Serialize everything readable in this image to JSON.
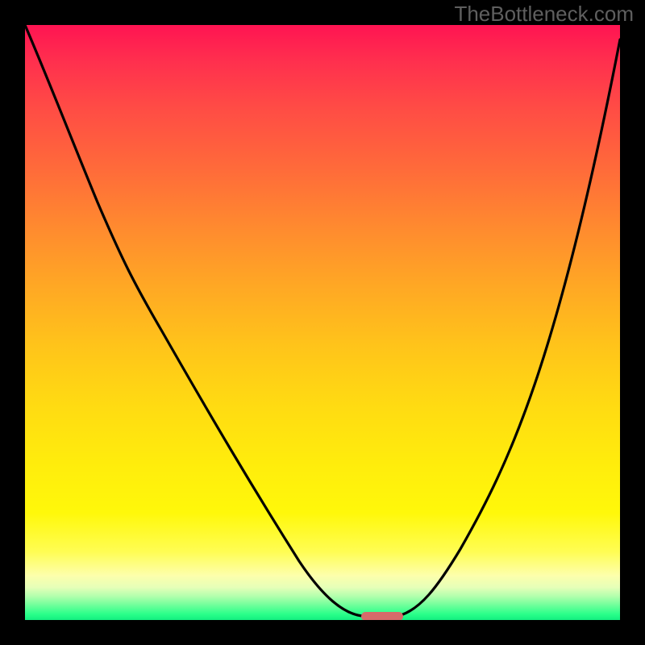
{
  "watermark": "TheBottleneck.com",
  "chart_data": {
    "type": "line",
    "title": "",
    "xlabel": "",
    "ylabel": "",
    "xlim": [
      0,
      100
    ],
    "ylim": [
      0,
      100
    ],
    "series": [
      {
        "name": "bottleneck-curve",
        "x": [
          0,
          8,
          18,
          26,
          33,
          40,
          46,
          51,
          55,
          57.5,
          59,
          61,
          63,
          65,
          68,
          74,
          82,
          92,
          100
        ],
        "values": [
          100,
          84,
          68,
          55,
          45,
          33,
          20,
          9,
          2,
          0.5,
          0.5,
          0.5,
          2,
          6,
          15,
          33,
          55,
          80,
          98
        ]
      }
    ],
    "marker": {
      "name": "optimal-range-bar",
      "x_start": 56.5,
      "x_end": 63.5,
      "y": 0.3,
      "color": "#d66a6a"
    },
    "background_gradient": {
      "stops": [
        {
          "pos": 0.0,
          "color": "#ff1452"
        },
        {
          "pos": 0.14,
          "color": "#ff4c45"
        },
        {
          "pos": 0.34,
          "color": "#ff8a2f"
        },
        {
          "pos": 0.54,
          "color": "#ffc41a"
        },
        {
          "pos": 0.74,
          "color": "#ffed0c"
        },
        {
          "pos": 0.885,
          "color": "#fffd53"
        },
        {
          "pos": 0.945,
          "color": "#e6ffb8"
        },
        {
          "pos": 0.99,
          "color": "#2bff8a"
        },
        {
          "pos": 1.0,
          "color": "#13ef80"
        }
      ]
    }
  }
}
